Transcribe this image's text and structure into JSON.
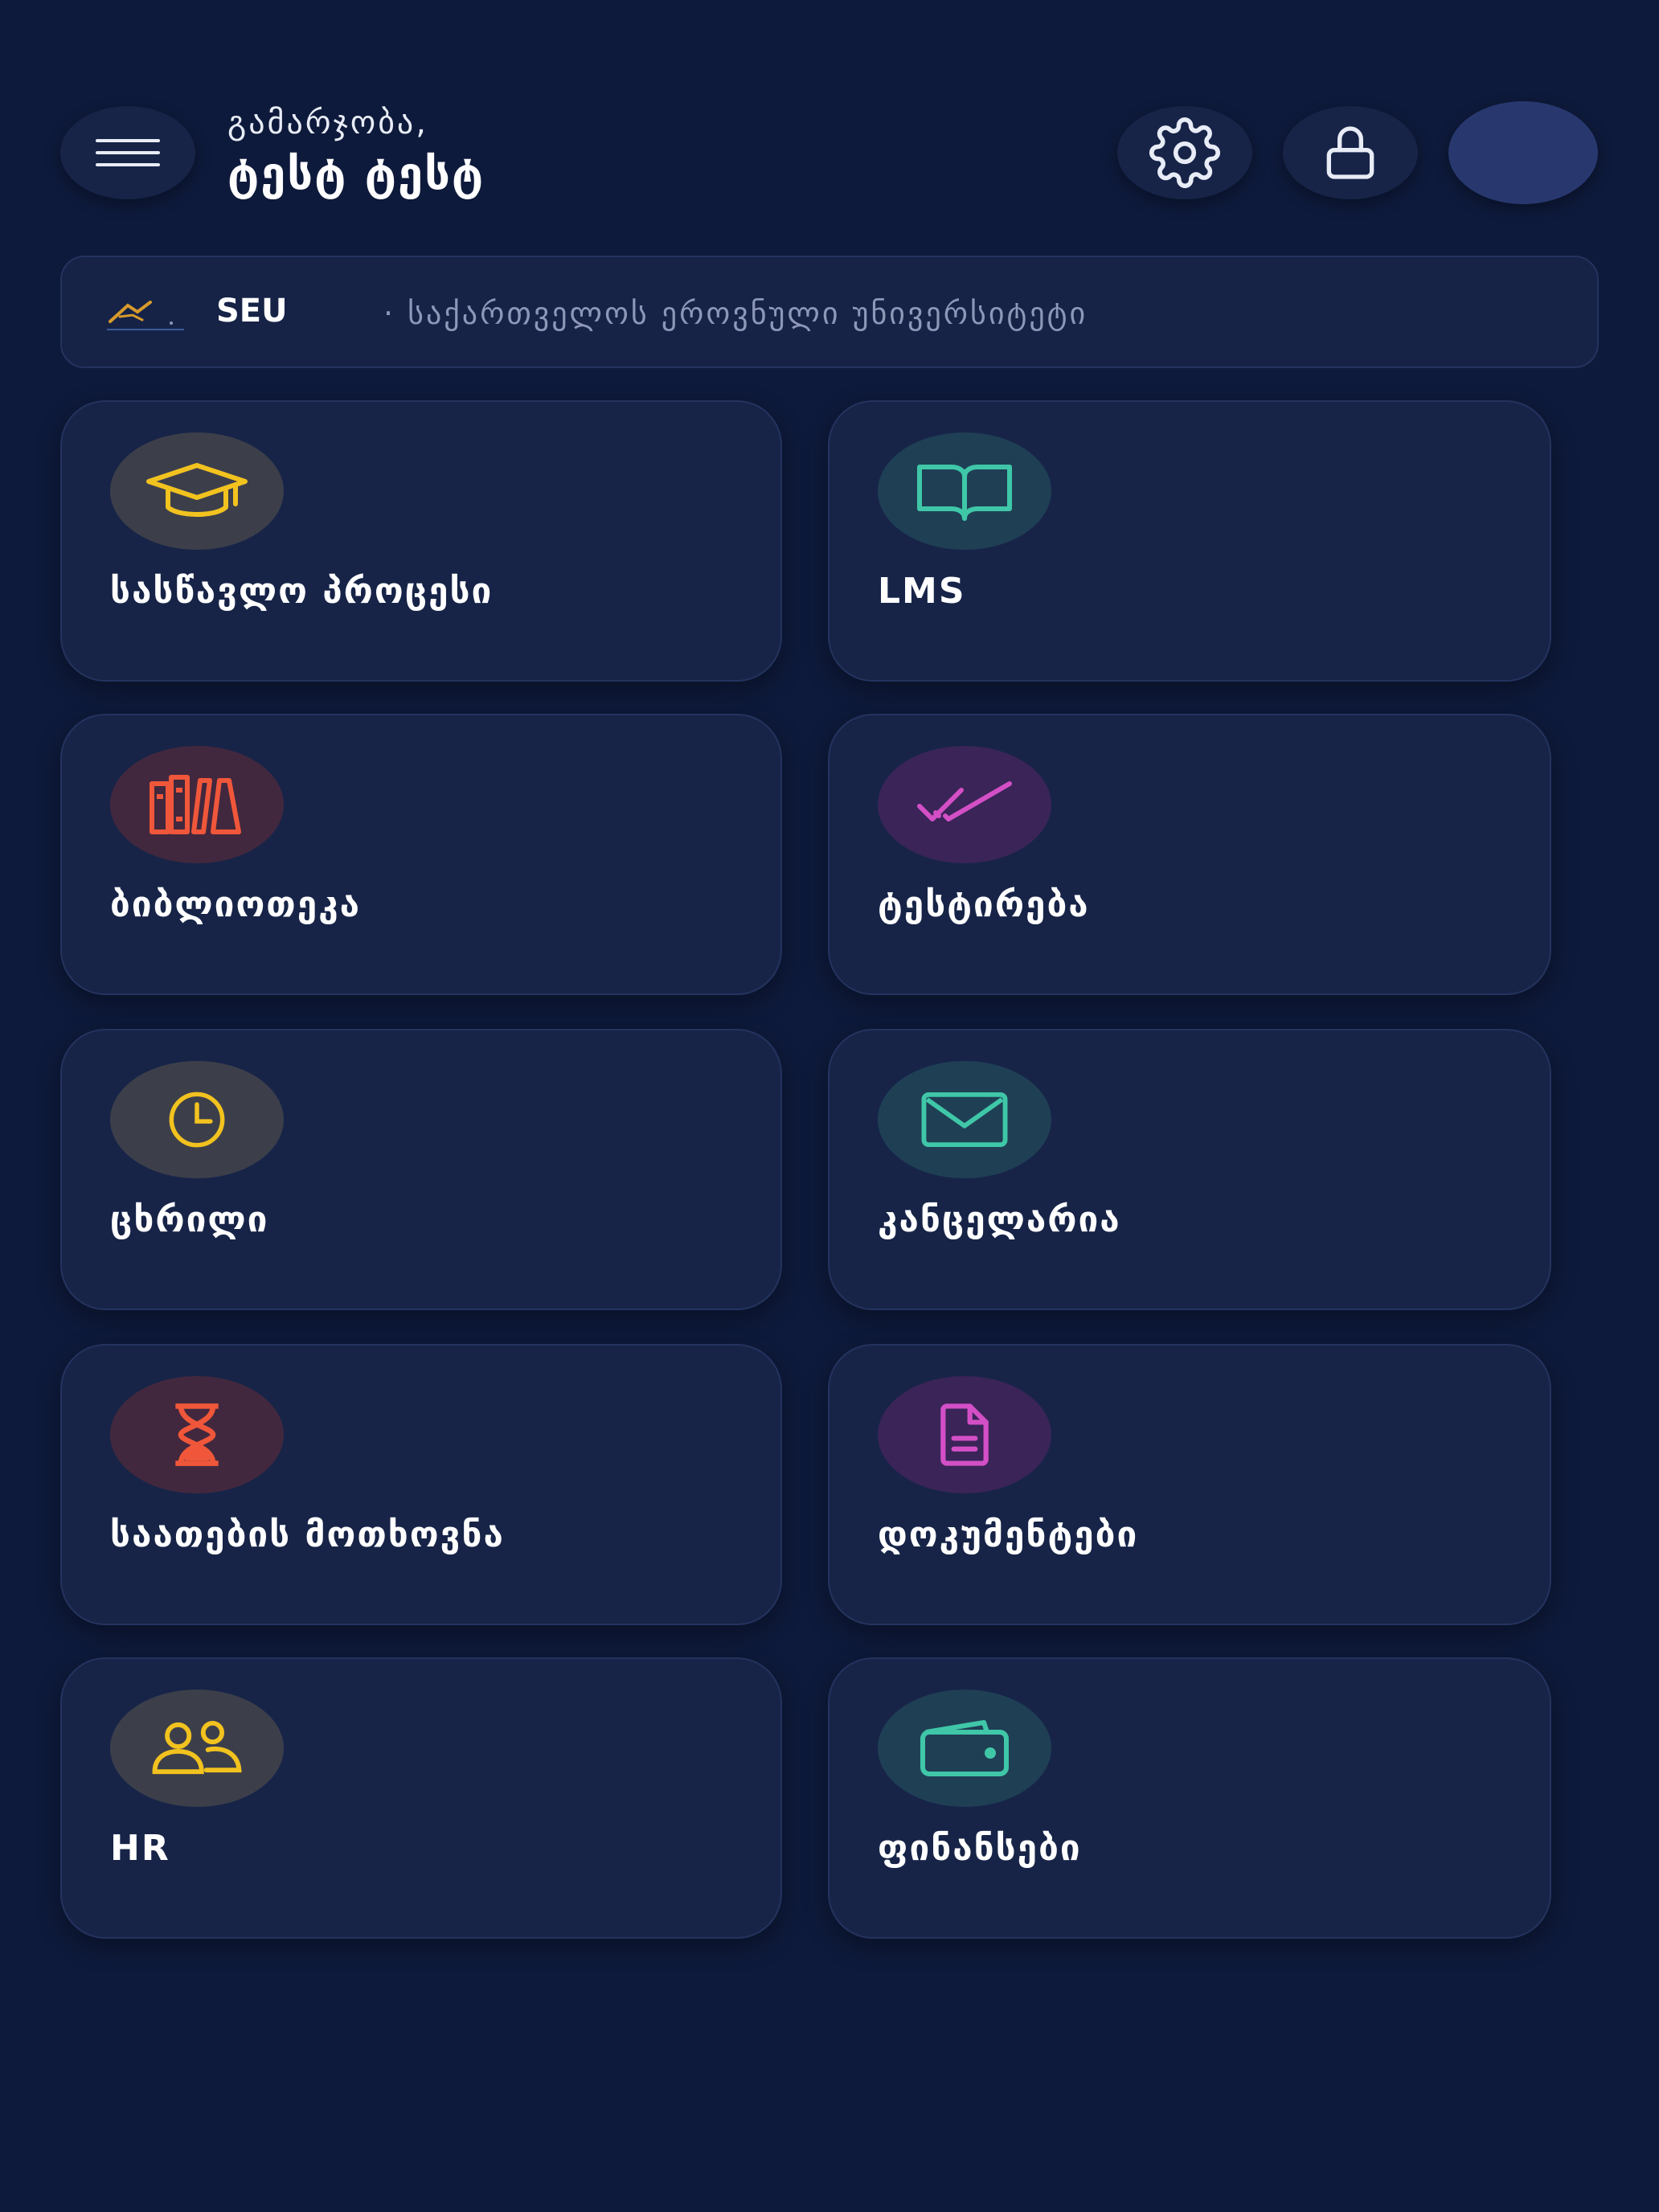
{
  "header": {
    "greeting": "გამარჯობა,",
    "user_name": "ტესტ ტესტ",
    "icons": {
      "menu": "hamburger-menu-icon",
      "settings": "gear-icon",
      "lock": "lock-icon"
    }
  },
  "university": {
    "abbr": "SEU",
    "name": "· საქართველოს ეროვნული უნივერსიტეტი"
  },
  "modules": [
    {
      "label": "სასწავლო პროცესი",
      "icon": "graduation-cap-icon",
      "color": "#f2c21f"
    },
    {
      "label": "LMS",
      "icon": "open-book-icon",
      "color": "#3fc7a8"
    },
    {
      "label": "ბიბლიოთეკა",
      "icon": "library-books-icon",
      "color": "#f0573a"
    },
    {
      "label": "ტესტირება",
      "icon": "double-check-icon",
      "color": "#d34fc6"
    },
    {
      "label": "ცხრილი",
      "icon": "clock-icon",
      "color": "#f2c21f"
    },
    {
      "label": "კანცელარია",
      "icon": "envelope-icon",
      "color": "#3fc7a8"
    },
    {
      "label": "საათების მოთხოვნა",
      "icon": "hourglass-icon",
      "color": "#f0573a"
    },
    {
      "label": "დოკუმენტები",
      "icon": "document-icon",
      "color": "#d34fc6"
    },
    {
      "label": "HR",
      "icon": "users-icon",
      "color": "#f2c21f"
    },
    {
      "label": "ფინანსები",
      "icon": "wallet-icon",
      "color": "#3fc7a8"
    }
  ]
}
